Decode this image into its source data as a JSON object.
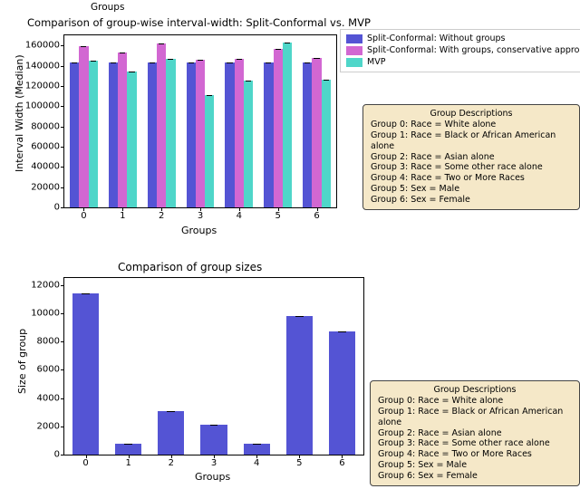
{
  "top_cropped_label": "Groups",
  "chart1": {
    "title": "Comparison of group-wise interval-width: Split-Conformal vs. MVP",
    "xlabel": "Groups",
    "ylabel": "Interval Width (Median)",
    "xticks": [
      "0",
      "1",
      "2",
      "3",
      "4",
      "5",
      "6"
    ],
    "yticks": [
      "0",
      "20000",
      "40000",
      "60000",
      "80000",
      "100000",
      "120000",
      "140000",
      "160000"
    ],
    "legend": [
      "Split-Conformal: Without groups",
      "Split-Conformal: With groups, conservative approach",
      "MVP"
    ]
  },
  "chart2": {
    "title": "Comparison of group sizes",
    "xlabel": "Groups",
    "ylabel": "Size of group",
    "xticks": [
      "0",
      "1",
      "2",
      "3",
      "4",
      "5",
      "6"
    ],
    "yticks": [
      "0",
      "2000",
      "4000",
      "6000",
      "8000",
      "10000",
      "12000"
    ]
  },
  "groupbox": {
    "title": "Group Descriptions",
    "lines": [
      "Group 0: Race = White alone",
      "Group 1: Race = Black or African American alone",
      "Group 2: Race = Asian alone",
      "Group 3: Race = Some other race alone",
      "Group 4: Race = Two or More Races",
      "Group 5: Sex = Male",
      "Group 6: Sex = Female"
    ]
  },
  "colors": {
    "series1": "#5454d4",
    "series2": "#d267d2",
    "series3": "#4fd6c9",
    "single": "#5454d4"
  },
  "chart_data": [
    {
      "type": "bar",
      "title": "Comparison of group-wise interval-width: Split-Conformal vs. MVP",
      "xlabel": "Groups",
      "ylabel": "Interval Width (Median)",
      "categories": [
        "0",
        "1",
        "2",
        "3",
        "4",
        "5",
        "6"
      ],
      "series": [
        {
          "name": "Split-Conformal: Without groups",
          "values": [
            143000,
            143000,
            143000,
            143000,
            143000,
            143000,
            143000
          ]
        },
        {
          "name": "Split-Conformal: With groups, conservative approach",
          "values": [
            159000,
            153000,
            162000,
            146000,
            147000,
            157000,
            148000
          ]
        },
        {
          "name": "MVP",
          "values": [
            145000,
            134000,
            147000,
            111000,
            125000,
            163000,
            126000
          ]
        }
      ],
      "ylim": [
        0,
        170000
      ],
      "legend_position": "upper-right-outside"
    },
    {
      "type": "bar",
      "title": "Comparison of group sizes",
      "xlabel": "Groups",
      "ylabel": "Size of group",
      "categories": [
        "0",
        "1",
        "2",
        "3",
        "4",
        "5",
        "6"
      ],
      "series": [
        {
          "name": "Size of group",
          "values": [
            11400,
            800,
            3100,
            2100,
            800,
            9800,
            8700
          ]
        }
      ],
      "ylim": [
        0,
        12500
      ]
    }
  ]
}
